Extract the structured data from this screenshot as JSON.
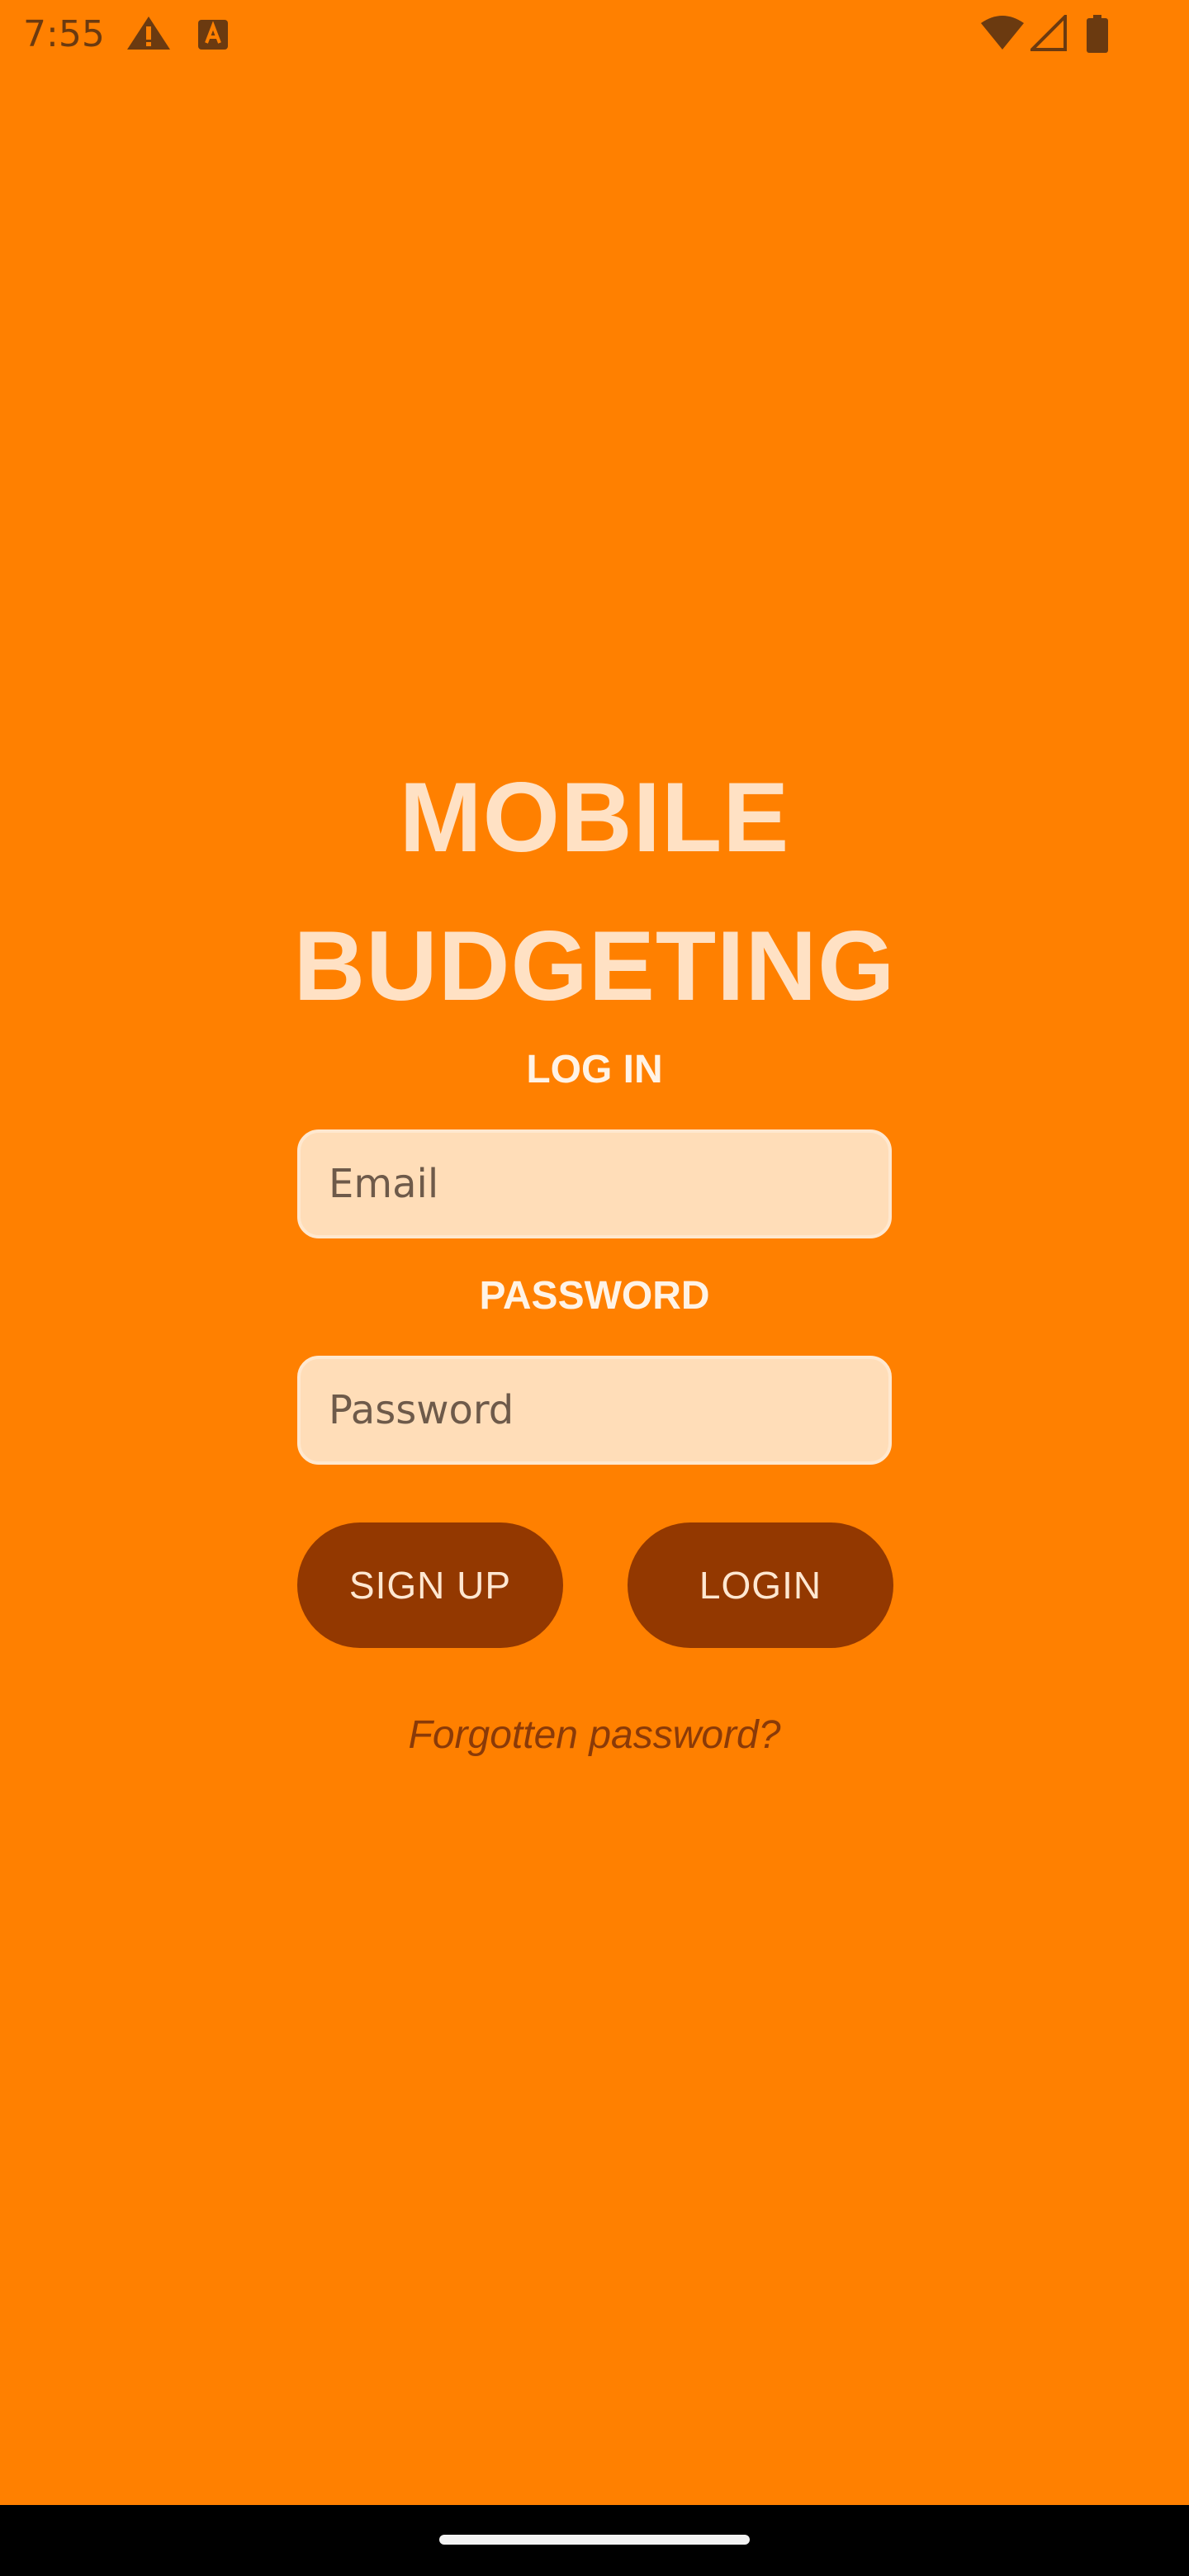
{
  "status_bar": {
    "time": "7:55",
    "icons": [
      "warning-icon",
      "text-a-icon",
      "wifi-icon",
      "signal-icon",
      "battery-icon"
    ]
  },
  "app": {
    "title_line1": "MOBILE",
    "title_line2": "BUDGETING"
  },
  "login": {
    "label": "LOG IN",
    "email_placeholder": "Email",
    "email_value": "",
    "password_label": "PASSWORD",
    "password_placeholder": "Password",
    "password_value": ""
  },
  "buttons": {
    "signup": "SIGN UP",
    "login": "LOGIN"
  },
  "forgot_password": "Forgotten password?",
  "colors": {
    "background": "#FF8000",
    "title": "#FFE1C4",
    "field_bg": "#FFDDB8",
    "button_bg": "#933800",
    "button_text": "#FFE7D1",
    "link": "#8A3A08"
  }
}
